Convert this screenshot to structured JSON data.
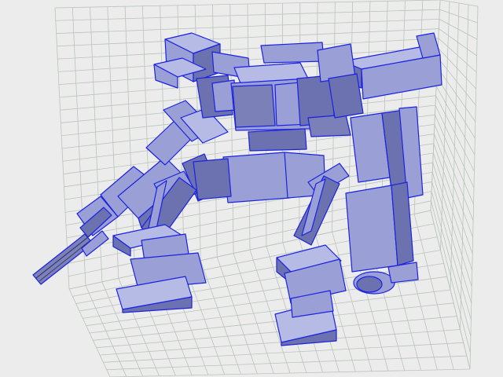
{
  "viewport": {
    "background": "#ececec",
    "grid_color": "#b9c4b9",
    "mesh_fill": "#9aa0d6",
    "mesh_fill_dark": "#6c72b0",
    "mesh_fill_light": "#b6bbe6",
    "wire_color": "#1a22e0",
    "edge_color": "#20245a"
  },
  "model": {
    "icon": "mech-robot-wireframe-icon"
  }
}
